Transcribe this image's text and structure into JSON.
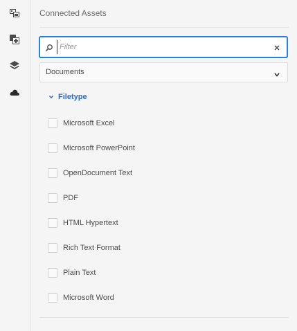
{
  "panel": {
    "title": "Connected Assets"
  },
  "rail": {
    "items": [
      {
        "icon": "assets-icon"
      },
      {
        "icon": "add-media-icon"
      },
      {
        "icon": "layers-icon"
      },
      {
        "icon": "cloud-icon"
      }
    ]
  },
  "search": {
    "placeholder": "Filter",
    "value": ""
  },
  "type_select": {
    "value": "Documents"
  },
  "facet": {
    "label": "Filetype",
    "options": [
      {
        "label": "Microsoft Excel",
        "checked": false
      },
      {
        "label": "Microsoft PowerPoint",
        "checked": false
      },
      {
        "label": "OpenDocument Text",
        "checked": false
      },
      {
        "label": "PDF",
        "checked": false
      },
      {
        "label": "HTML Hypertext",
        "checked": false
      },
      {
        "label": "Rich Text Format",
        "checked": false
      },
      {
        "label": "Plain Text",
        "checked": false
      },
      {
        "label": "Microsoft Word",
        "checked": false
      }
    ]
  },
  "colors": {
    "accent": "#2680eb",
    "facet_label": "#2c6bc9"
  }
}
